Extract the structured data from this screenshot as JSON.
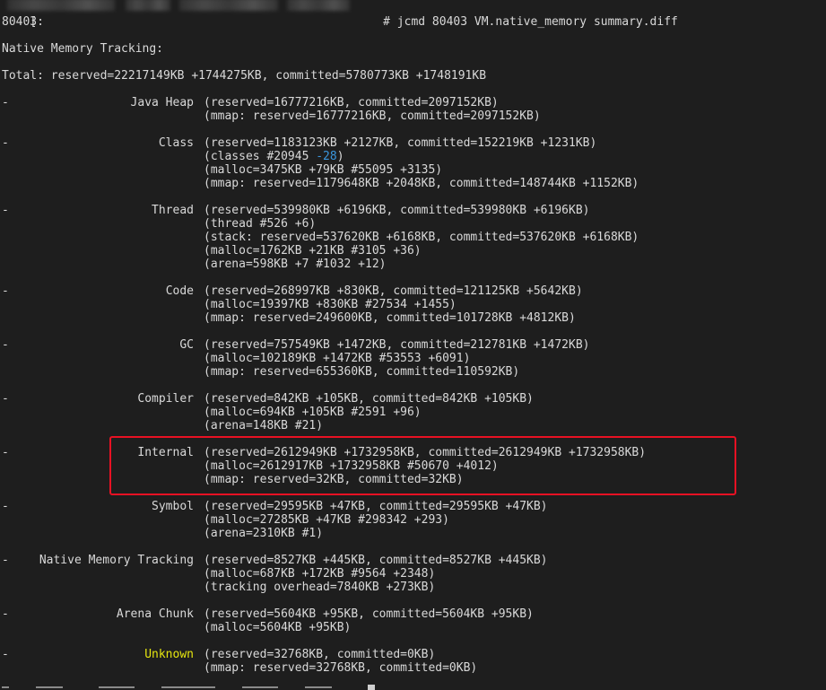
{
  "terminal": {
    "prompt_bracket": "[",
    "prompt_suffix": "# jcmd 80403 VM.native_memory summary.diff",
    "pid_line": "80403:",
    "header": "Native Memory Tracking:",
    "total_line": "Total: reserved=22217149KB +1744275KB, committed=5780773KB +1748191KB",
    "dash": "-",
    "sections": [
      {
        "name": "Java Heap",
        "lines": [
          "(reserved=16777216KB, committed=2097152KB)",
          "(mmap: reserved=16777216KB, committed=2097152KB)"
        ]
      },
      {
        "name": "Class",
        "lines": [
          "(reserved=1183123KB +2127KB, committed=152219KB +1231KB)",
          "(classes #20945 ",
          "(malloc=3475KB +79KB #55095 +3135)",
          "(mmap: reserved=1179648KB +2048KB, committed=148744KB +1152KB)"
        ],
        "classes_delta": "-28",
        "classes_close": ")"
      },
      {
        "name": "Thread",
        "lines": [
          "(reserved=539980KB +6196KB, committed=539980KB +6196KB)",
          "(thread #526 +6)",
          "(stack: reserved=537620KB +6168KB, committed=537620KB +6168KB)",
          "(malloc=1762KB +21KB #3105 +36)",
          "(arena=598KB +7 #1032 +12)"
        ]
      },
      {
        "name": "Code",
        "lines": [
          "(reserved=268997KB +830KB, committed=121125KB +5642KB)",
          "(malloc=19397KB +830KB #27534 +1455)",
          "(mmap: reserved=249600KB, committed=101728KB +4812KB)"
        ]
      },
      {
        "name": "GC",
        "lines": [
          "(reserved=757549KB +1472KB, committed=212781KB +1472KB)",
          "(malloc=102189KB +1472KB #53553 +6091)",
          "(mmap: reserved=655360KB, committed=110592KB)"
        ]
      },
      {
        "name": "Compiler",
        "lines": [
          "(reserved=842KB +105KB, committed=842KB +105KB)",
          "(malloc=694KB +105KB #2591 +96)",
          "(arena=148KB #21)"
        ]
      },
      {
        "name": "Internal",
        "lines": [
          "(reserved=2612949KB +1732958KB, committed=2612949KB +1732958KB)",
          "(malloc=2612917KB +1732958KB #50670 +4012)",
          "(mmap: reserved=32KB, committed=32KB)"
        ]
      },
      {
        "name": "Symbol",
        "lines": [
          "(reserved=29595KB +47KB, committed=29595KB +47KB)",
          "(malloc=27285KB +47KB #298342 +293)",
          "(arena=2310KB #1)"
        ]
      },
      {
        "name": "Native Memory Tracking",
        "lines": [
          "(reserved=8527KB +445KB, committed=8527KB +445KB)",
          "(malloc=687KB +172KB #9564 +2348)",
          "(tracking overhead=7840KB +273KB)"
        ]
      },
      {
        "name": "Arena Chunk",
        "lines": [
          "(reserved=5604KB +95KB, committed=5604KB +95KB)",
          "(malloc=5604KB +95KB)"
        ]
      },
      {
        "name": "Unknown",
        "lines": [
          "(reserved=32768KB, committed=0KB)",
          "(mmap: reserved=32768KB, committed=0KB)"
        ]
      }
    ],
    "colors": {
      "background": "#1e1e1e",
      "text": "#d9d9d9",
      "delta_blue": "#3a96dd",
      "unknown_yellow": "#e5e510",
      "highlight_border": "#e81123"
    }
  }
}
